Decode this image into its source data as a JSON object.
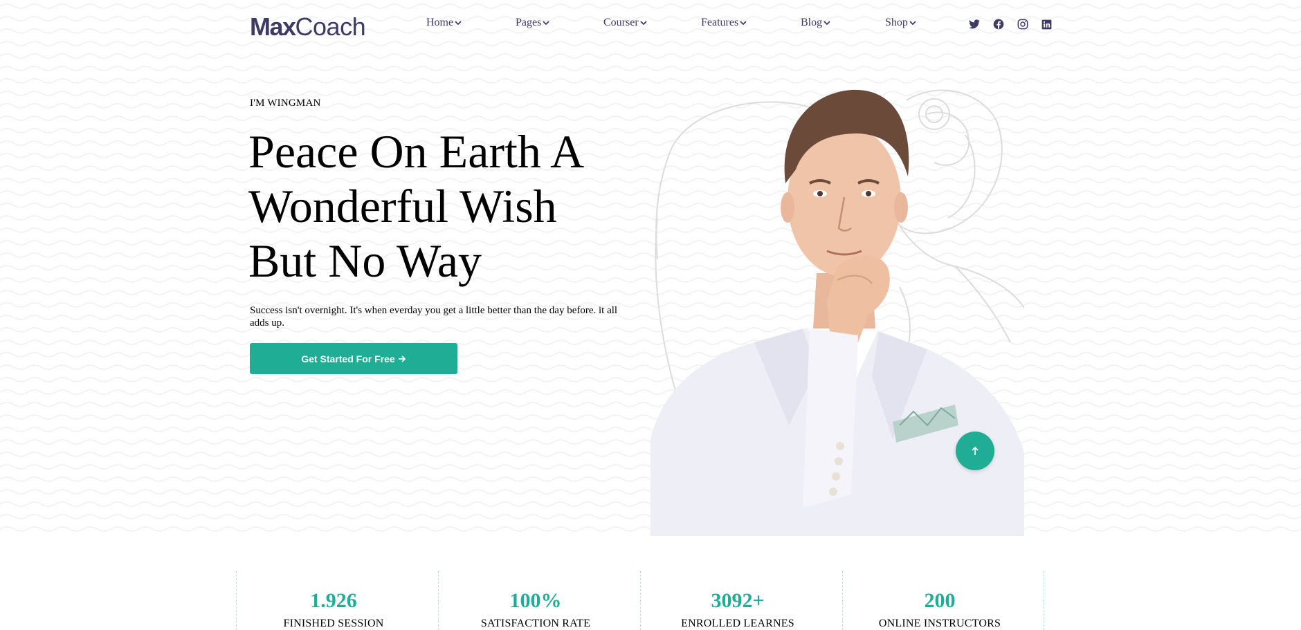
{
  "header": {
    "logo_bold": "Max",
    "logo_light": "Coach",
    "nav": [
      {
        "label": "Home"
      },
      {
        "label": "Pages"
      },
      {
        "label": "Courser"
      },
      {
        "label": "Features"
      },
      {
        "label": "Blog"
      },
      {
        "label": "Shop"
      }
    ],
    "socials": [
      "twitter-icon",
      "facebook-icon",
      "instagram-icon",
      "linkedin-icon"
    ]
  },
  "hero": {
    "eyebrow": "I'M WINGMAN",
    "headline_line1": "Peace On Earth A",
    "headline_line2": "Wonderful Wish",
    "headline_line3": "But No Way",
    "lead": "Success isn't overnight. It's when everday you get a little better than the day before. it all adds up.",
    "cta_label": "Get Started For Free"
  },
  "stats": [
    {
      "value": "1.926",
      "label": "FINISHED SESSION"
    },
    {
      "value": "100%",
      "label": "SATISFACTION RATE"
    },
    {
      "value": "3092+",
      "label": "ENROLLED LEARNES"
    },
    {
      "value": "200",
      "label": "ONLINE INSTRUCTORS"
    }
  ],
  "colors": {
    "brand": "#3f3a64",
    "accent": "#20ad96"
  }
}
